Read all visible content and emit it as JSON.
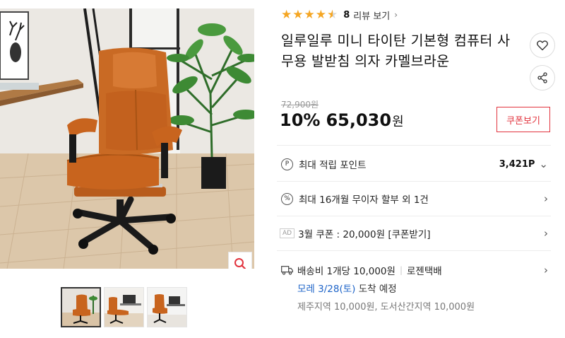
{
  "rating": {
    "stars": 4.5,
    "count": "8",
    "review_label": "리뷰 보기",
    "chevron": "›",
    "star_color": "#f5a623"
  },
  "product": {
    "title": "일루일루 미니 타이탄 기본형 컴퓨터 사무용 발받침 의자 카멜브라운",
    "original_price": "72,900원",
    "discount": "10%",
    "sale_price": "65,030",
    "currency": "원"
  },
  "buttons": {
    "coupon_view": "쿠폰보기",
    "like_icon": "heart-icon",
    "share_icon": "share-icon",
    "zoom_icon": "search-icon"
  },
  "points": {
    "icon": "P",
    "label": "최대 적립 포인트",
    "value": "3,421P",
    "chevron": "⌄"
  },
  "installment": {
    "icon": "%",
    "label": "최대 16개월 무이자 할부 외 1건",
    "chevron": "›"
  },
  "coupon": {
    "badge": "AD",
    "label": "3월 쿠폰 : 20,000원 [쿠폰받기]",
    "chevron": "›"
  },
  "shipping": {
    "fee": "배송비 1개당 10,000원",
    "separator": "|",
    "carrier": "로젠택배",
    "eta_date": "모레 3/28(토)",
    "eta_rest": " 도착 예정",
    "extra": "제주지역 10,000원, 도서산간지역 10,000원",
    "chevron": "›"
  },
  "colors": {
    "accent_red": "#e2343e",
    "link_blue": "#1e64c8",
    "chair_camel": "#c8641e"
  }
}
